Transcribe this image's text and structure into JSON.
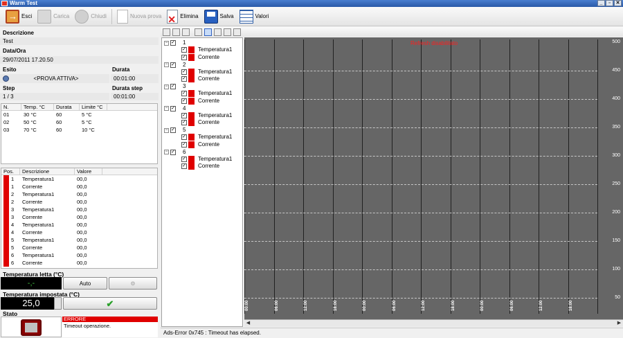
{
  "window": {
    "title": "Warm Test"
  },
  "toolbar": {
    "esci": "Esci",
    "carica": "Carica",
    "chiudi": "Chiudi",
    "nuova_prova": "Nuova prova",
    "elimina": "Elimina",
    "salva": "Salva",
    "valori": "Valori"
  },
  "info": {
    "descrizione_label": "Descrizione",
    "descrizione": "Test",
    "data_label": "Data/Ora",
    "data": "29/07/2011 17.20.50",
    "esito_label": "Esito",
    "esito": "<PROVA ATTIVA>",
    "durata_label": "Durata",
    "durata": "00:01:00",
    "step_label": "Step",
    "step": "1 / 3",
    "durata_step_label": "Durata step",
    "durata_step": "00:01:00"
  },
  "steps": {
    "headers": [
      "N.",
      "Temp. °C",
      "Durata",
      "Limite °C"
    ],
    "rows": [
      [
        "01",
        "30 °C",
        "60",
        "5 °C"
      ],
      [
        "02",
        "50 °C",
        "60",
        "5 °C"
      ],
      [
        "03",
        "70 °C",
        "60",
        "10 °C"
      ]
    ]
  },
  "values": {
    "headers": [
      "Pos.",
      "Descrizione",
      "Valore"
    ],
    "rows": [
      [
        "1",
        "Temperatura1",
        "00,0"
      ],
      [
        "1",
        "Corrente",
        "00,0"
      ],
      [
        "2",
        "Temperatura1",
        "00,0"
      ],
      [
        "2",
        "Corrente",
        "00,0"
      ],
      [
        "3",
        "Temperatura1",
        "00,0"
      ],
      [
        "3",
        "Corrente",
        "00,0"
      ],
      [
        "4",
        "Temperatura1",
        "00,0"
      ],
      [
        "4",
        "Corrente",
        "00,0"
      ],
      [
        "5",
        "Temperatura1",
        "00,0"
      ],
      [
        "5",
        "Corrente",
        "00,0"
      ],
      [
        "6",
        "Temperatura1",
        "00,0"
      ],
      [
        "6",
        "Corrente",
        "00,0"
      ]
    ]
  },
  "temp_read": {
    "label": "Temperatura letta (°C)",
    "value": "-,-",
    "auto_button": "Auto"
  },
  "temp_set": {
    "label": "Temperatura impostata (°C)",
    "value": "25,0"
  },
  "stato": {
    "label": "Stato",
    "error": "ERRORE",
    "message": "Timeout operazione."
  },
  "tree": {
    "groups": [
      {
        "id": "1",
        "items": [
          "Temperatura1",
          "Corrente"
        ]
      },
      {
        "id": "2",
        "items": [
          "Temperatura1",
          "Corrente"
        ]
      },
      {
        "id": "3",
        "items": [
          "Temperatura1",
          "Corrente"
        ]
      },
      {
        "id": "4",
        "items": [
          "Temperatura1",
          "Corrente"
        ]
      },
      {
        "id": "5",
        "items": [
          "Temperatura1",
          "Corrente"
        ]
      },
      {
        "id": "6",
        "items": [
          "Temperatura1",
          "Corrente"
        ]
      }
    ]
  },
  "chart": {
    "notice": "Refresh disabilitato",
    "y_ticks": [
      "500",
      "450",
      "400",
      "350",
      "300",
      "250",
      "200",
      "150",
      "100",
      "50"
    ],
    "x_ticks": [
      "00:00",
      "06:00",
      "12:00",
      "18:00",
      "00:00",
      "06:00",
      "12:00",
      "18:00",
      "00:00",
      "06:00",
      "12:00",
      "18:00"
    ],
    "background": "#666666",
    "notice_color": "#ff1e1e"
  },
  "status_bar": {
    "text": "Ads-Error 0x745 : Timeout has elapsed."
  },
  "colors": {
    "accent_red": "#e00000",
    "ok_green": "#2aa02a"
  }
}
